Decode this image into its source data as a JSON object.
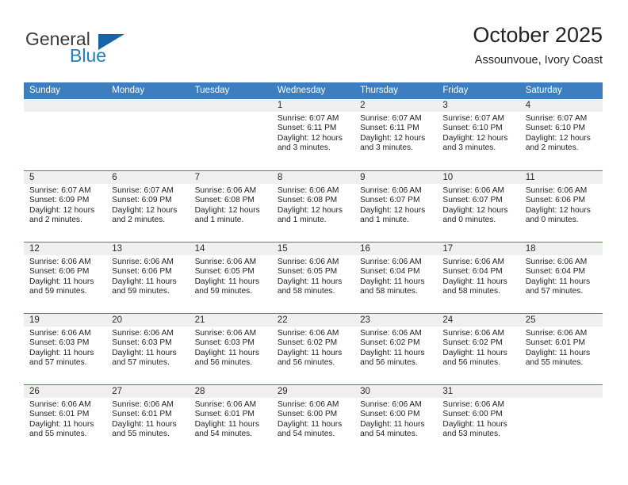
{
  "brand": {
    "word1": "General",
    "word2": "Blue",
    "logo_icon": "triangle-logo-icon",
    "accent_color": "#1565a8",
    "blue_text_color": "#1f7fc4"
  },
  "header": {
    "title": "October 2025",
    "subtitle": "Assounvoue, Ivory Coast"
  },
  "theme": {
    "header_blue": "#3c7ebf",
    "daynum_band": "#efefef",
    "text": "#1f1f1f"
  },
  "calendar": {
    "weekdays": [
      "Sunday",
      "Monday",
      "Tuesday",
      "Wednesday",
      "Thursday",
      "Friday",
      "Saturday"
    ],
    "weeks": [
      [
        {
          "day": "",
          "sunrise": "",
          "sunset": "",
          "daylight": ""
        },
        {
          "day": "",
          "sunrise": "",
          "sunset": "",
          "daylight": ""
        },
        {
          "day": "",
          "sunrise": "",
          "sunset": "",
          "daylight": ""
        },
        {
          "day": "1",
          "sunrise": "Sunrise: 6:07 AM",
          "sunset": "Sunset: 6:11 PM",
          "daylight": "Daylight: 12 hours and 3 minutes."
        },
        {
          "day": "2",
          "sunrise": "Sunrise: 6:07 AM",
          "sunset": "Sunset: 6:11 PM",
          "daylight": "Daylight: 12 hours and 3 minutes."
        },
        {
          "day": "3",
          "sunrise": "Sunrise: 6:07 AM",
          "sunset": "Sunset: 6:10 PM",
          "daylight": "Daylight: 12 hours and 3 minutes."
        },
        {
          "day": "4",
          "sunrise": "Sunrise: 6:07 AM",
          "sunset": "Sunset: 6:10 PM",
          "daylight": "Daylight: 12 hours and 2 minutes."
        }
      ],
      [
        {
          "day": "5",
          "sunrise": "Sunrise: 6:07 AM",
          "sunset": "Sunset: 6:09 PM",
          "daylight": "Daylight: 12 hours and 2 minutes."
        },
        {
          "day": "6",
          "sunrise": "Sunrise: 6:07 AM",
          "sunset": "Sunset: 6:09 PM",
          "daylight": "Daylight: 12 hours and 2 minutes."
        },
        {
          "day": "7",
          "sunrise": "Sunrise: 6:06 AM",
          "sunset": "Sunset: 6:08 PM",
          "daylight": "Daylight: 12 hours and 1 minute."
        },
        {
          "day": "8",
          "sunrise": "Sunrise: 6:06 AM",
          "sunset": "Sunset: 6:08 PM",
          "daylight": "Daylight: 12 hours and 1 minute."
        },
        {
          "day": "9",
          "sunrise": "Sunrise: 6:06 AM",
          "sunset": "Sunset: 6:07 PM",
          "daylight": "Daylight: 12 hours and 1 minute."
        },
        {
          "day": "10",
          "sunrise": "Sunrise: 6:06 AM",
          "sunset": "Sunset: 6:07 PM",
          "daylight": "Daylight: 12 hours and 0 minutes."
        },
        {
          "day": "11",
          "sunrise": "Sunrise: 6:06 AM",
          "sunset": "Sunset: 6:06 PM",
          "daylight": "Daylight: 12 hours and 0 minutes."
        }
      ],
      [
        {
          "day": "12",
          "sunrise": "Sunrise: 6:06 AM",
          "sunset": "Sunset: 6:06 PM",
          "daylight": "Daylight: 11 hours and 59 minutes."
        },
        {
          "day": "13",
          "sunrise": "Sunrise: 6:06 AM",
          "sunset": "Sunset: 6:06 PM",
          "daylight": "Daylight: 11 hours and 59 minutes."
        },
        {
          "day": "14",
          "sunrise": "Sunrise: 6:06 AM",
          "sunset": "Sunset: 6:05 PM",
          "daylight": "Daylight: 11 hours and 59 minutes."
        },
        {
          "day": "15",
          "sunrise": "Sunrise: 6:06 AM",
          "sunset": "Sunset: 6:05 PM",
          "daylight": "Daylight: 11 hours and 58 minutes."
        },
        {
          "day": "16",
          "sunrise": "Sunrise: 6:06 AM",
          "sunset": "Sunset: 6:04 PM",
          "daylight": "Daylight: 11 hours and 58 minutes."
        },
        {
          "day": "17",
          "sunrise": "Sunrise: 6:06 AM",
          "sunset": "Sunset: 6:04 PM",
          "daylight": "Daylight: 11 hours and 58 minutes."
        },
        {
          "day": "18",
          "sunrise": "Sunrise: 6:06 AM",
          "sunset": "Sunset: 6:04 PM",
          "daylight": "Daylight: 11 hours and 57 minutes."
        }
      ],
      [
        {
          "day": "19",
          "sunrise": "Sunrise: 6:06 AM",
          "sunset": "Sunset: 6:03 PM",
          "daylight": "Daylight: 11 hours and 57 minutes."
        },
        {
          "day": "20",
          "sunrise": "Sunrise: 6:06 AM",
          "sunset": "Sunset: 6:03 PM",
          "daylight": "Daylight: 11 hours and 57 minutes."
        },
        {
          "day": "21",
          "sunrise": "Sunrise: 6:06 AM",
          "sunset": "Sunset: 6:03 PM",
          "daylight": "Daylight: 11 hours and 56 minutes."
        },
        {
          "day": "22",
          "sunrise": "Sunrise: 6:06 AM",
          "sunset": "Sunset: 6:02 PM",
          "daylight": "Daylight: 11 hours and 56 minutes."
        },
        {
          "day": "23",
          "sunrise": "Sunrise: 6:06 AM",
          "sunset": "Sunset: 6:02 PM",
          "daylight": "Daylight: 11 hours and 56 minutes."
        },
        {
          "day": "24",
          "sunrise": "Sunrise: 6:06 AM",
          "sunset": "Sunset: 6:02 PM",
          "daylight": "Daylight: 11 hours and 56 minutes."
        },
        {
          "day": "25",
          "sunrise": "Sunrise: 6:06 AM",
          "sunset": "Sunset: 6:01 PM",
          "daylight": "Daylight: 11 hours and 55 minutes."
        }
      ],
      [
        {
          "day": "26",
          "sunrise": "Sunrise: 6:06 AM",
          "sunset": "Sunset: 6:01 PM",
          "daylight": "Daylight: 11 hours and 55 minutes."
        },
        {
          "day": "27",
          "sunrise": "Sunrise: 6:06 AM",
          "sunset": "Sunset: 6:01 PM",
          "daylight": "Daylight: 11 hours and 55 minutes."
        },
        {
          "day": "28",
          "sunrise": "Sunrise: 6:06 AM",
          "sunset": "Sunset: 6:01 PM",
          "daylight": "Daylight: 11 hours and 54 minutes."
        },
        {
          "day": "29",
          "sunrise": "Sunrise: 6:06 AM",
          "sunset": "Sunset: 6:00 PM",
          "daylight": "Daylight: 11 hours and 54 minutes."
        },
        {
          "day": "30",
          "sunrise": "Sunrise: 6:06 AM",
          "sunset": "Sunset: 6:00 PM",
          "daylight": "Daylight: 11 hours and 54 minutes."
        },
        {
          "day": "31",
          "sunrise": "Sunrise: 6:06 AM",
          "sunset": "Sunset: 6:00 PM",
          "daylight": "Daylight: 11 hours and 53 minutes."
        },
        {
          "day": "",
          "sunrise": "",
          "sunset": "",
          "daylight": ""
        }
      ]
    ]
  }
}
